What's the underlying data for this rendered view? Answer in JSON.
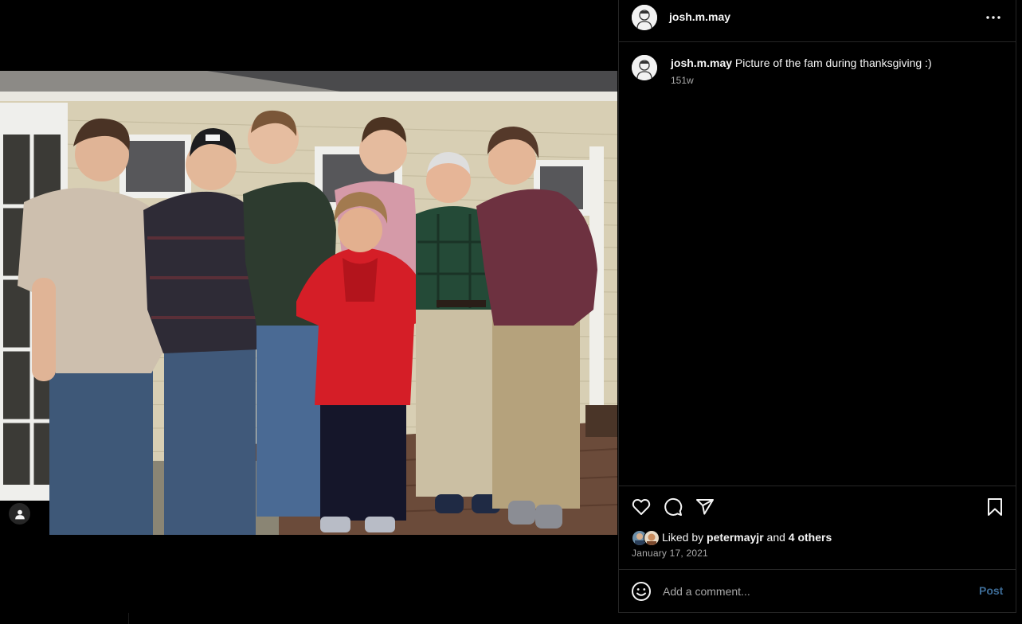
{
  "post": {
    "username": "josh.m.may",
    "caption": "Picture of the fam during thanksgiving :)",
    "age": "151w",
    "date": "January 17, 2021"
  },
  "likes": {
    "prefix": "Liked by ",
    "first_liker": "petermayjr",
    "middle": " and ",
    "others": "4 others"
  },
  "comment": {
    "placeholder": "Add a comment...",
    "post_label": "Post"
  },
  "icons": {
    "more": "more-horizontal-icon",
    "like": "heart-icon",
    "comment": "comment-bubble-icon",
    "share": "paper-plane-icon",
    "save": "bookmark-icon",
    "emoji": "smiley-icon",
    "tag": "user-tag-icon"
  },
  "colors": {
    "background": "#000000",
    "divider": "#262626",
    "text": "#f5f5f5",
    "secondary_text": "#a8a8a8",
    "post_button": "#3d6c97"
  }
}
